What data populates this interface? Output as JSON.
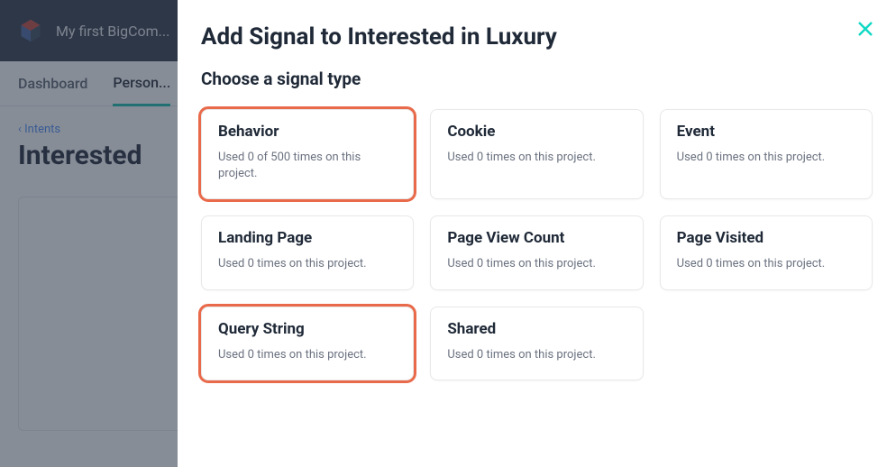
{
  "header": {
    "project_title": "My first BigCom..."
  },
  "tabs": {
    "dashboard": "Dashboard",
    "personalization": "Person..."
  },
  "page": {
    "breadcrumb": "‹ Intents",
    "heading": "Interested "
  },
  "modal": {
    "title": "Add Signal to Interested in Luxury",
    "subtitle": "Choose a signal type"
  },
  "tiles": [
    {
      "title": "Behavior",
      "desc": "Used 0 of 500 times on this project.",
      "highlighted": true,
      "big": true
    },
    {
      "title": "Cookie",
      "desc": "Used 0 times on this project.",
      "highlighted": false
    },
    {
      "title": "Event",
      "desc": "Used 0 times on this project.",
      "highlighted": false
    },
    {
      "title": "Landing Page",
      "desc": "Used 0 times on this project.",
      "highlighted": false
    },
    {
      "title": "Page View Count",
      "desc": "Used 0 times on this project.",
      "highlighted": false
    },
    {
      "title": "Page Visited",
      "desc": "Used 0 times on this project.",
      "highlighted": false
    },
    {
      "title": "Query String",
      "desc": "Used 0 times on this project.",
      "highlighted": true
    },
    {
      "title": "Shared",
      "desc": "Used 0 times on this project.",
      "highlighted": false
    }
  ]
}
